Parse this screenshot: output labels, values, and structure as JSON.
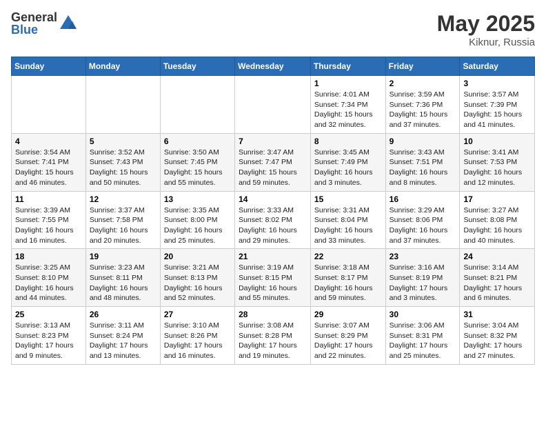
{
  "header": {
    "logo_general": "General",
    "logo_blue": "Blue",
    "month_year": "May 2025",
    "location": "Kiknur, Russia"
  },
  "days_of_week": [
    "Sunday",
    "Monday",
    "Tuesday",
    "Wednesday",
    "Thursday",
    "Friday",
    "Saturday"
  ],
  "weeks": [
    [
      {
        "day": "",
        "info": ""
      },
      {
        "day": "",
        "info": ""
      },
      {
        "day": "",
        "info": ""
      },
      {
        "day": "",
        "info": ""
      },
      {
        "day": "1",
        "info": "Sunrise: 4:01 AM\nSunset: 7:34 PM\nDaylight: 15 hours\nand 32 minutes."
      },
      {
        "day": "2",
        "info": "Sunrise: 3:59 AM\nSunset: 7:36 PM\nDaylight: 15 hours\nand 37 minutes."
      },
      {
        "day": "3",
        "info": "Sunrise: 3:57 AM\nSunset: 7:39 PM\nDaylight: 15 hours\nand 41 minutes."
      }
    ],
    [
      {
        "day": "4",
        "info": "Sunrise: 3:54 AM\nSunset: 7:41 PM\nDaylight: 15 hours\nand 46 minutes."
      },
      {
        "day": "5",
        "info": "Sunrise: 3:52 AM\nSunset: 7:43 PM\nDaylight: 15 hours\nand 50 minutes."
      },
      {
        "day": "6",
        "info": "Sunrise: 3:50 AM\nSunset: 7:45 PM\nDaylight: 15 hours\nand 55 minutes."
      },
      {
        "day": "7",
        "info": "Sunrise: 3:47 AM\nSunset: 7:47 PM\nDaylight: 15 hours\nand 59 minutes."
      },
      {
        "day": "8",
        "info": "Sunrise: 3:45 AM\nSunset: 7:49 PM\nDaylight: 16 hours\nand 3 minutes."
      },
      {
        "day": "9",
        "info": "Sunrise: 3:43 AM\nSunset: 7:51 PM\nDaylight: 16 hours\nand 8 minutes."
      },
      {
        "day": "10",
        "info": "Sunrise: 3:41 AM\nSunset: 7:53 PM\nDaylight: 16 hours\nand 12 minutes."
      }
    ],
    [
      {
        "day": "11",
        "info": "Sunrise: 3:39 AM\nSunset: 7:55 PM\nDaylight: 16 hours\nand 16 minutes."
      },
      {
        "day": "12",
        "info": "Sunrise: 3:37 AM\nSunset: 7:58 PM\nDaylight: 16 hours\nand 20 minutes."
      },
      {
        "day": "13",
        "info": "Sunrise: 3:35 AM\nSunset: 8:00 PM\nDaylight: 16 hours\nand 25 minutes."
      },
      {
        "day": "14",
        "info": "Sunrise: 3:33 AM\nSunset: 8:02 PM\nDaylight: 16 hours\nand 29 minutes."
      },
      {
        "day": "15",
        "info": "Sunrise: 3:31 AM\nSunset: 8:04 PM\nDaylight: 16 hours\nand 33 minutes."
      },
      {
        "day": "16",
        "info": "Sunrise: 3:29 AM\nSunset: 8:06 PM\nDaylight: 16 hours\nand 37 minutes."
      },
      {
        "day": "17",
        "info": "Sunrise: 3:27 AM\nSunset: 8:08 PM\nDaylight: 16 hours\nand 40 minutes."
      }
    ],
    [
      {
        "day": "18",
        "info": "Sunrise: 3:25 AM\nSunset: 8:10 PM\nDaylight: 16 hours\nand 44 minutes."
      },
      {
        "day": "19",
        "info": "Sunrise: 3:23 AM\nSunset: 8:11 PM\nDaylight: 16 hours\nand 48 minutes."
      },
      {
        "day": "20",
        "info": "Sunrise: 3:21 AM\nSunset: 8:13 PM\nDaylight: 16 hours\nand 52 minutes."
      },
      {
        "day": "21",
        "info": "Sunrise: 3:19 AM\nSunset: 8:15 PM\nDaylight: 16 hours\nand 55 minutes."
      },
      {
        "day": "22",
        "info": "Sunrise: 3:18 AM\nSunset: 8:17 PM\nDaylight: 16 hours\nand 59 minutes."
      },
      {
        "day": "23",
        "info": "Sunrise: 3:16 AM\nSunset: 8:19 PM\nDaylight: 17 hours\nand 3 minutes."
      },
      {
        "day": "24",
        "info": "Sunrise: 3:14 AM\nSunset: 8:21 PM\nDaylight: 17 hours\nand 6 minutes."
      }
    ],
    [
      {
        "day": "25",
        "info": "Sunrise: 3:13 AM\nSunset: 8:23 PM\nDaylight: 17 hours\nand 9 minutes."
      },
      {
        "day": "26",
        "info": "Sunrise: 3:11 AM\nSunset: 8:24 PM\nDaylight: 17 hours\nand 13 minutes."
      },
      {
        "day": "27",
        "info": "Sunrise: 3:10 AM\nSunset: 8:26 PM\nDaylight: 17 hours\nand 16 minutes."
      },
      {
        "day": "28",
        "info": "Sunrise: 3:08 AM\nSunset: 8:28 PM\nDaylight: 17 hours\nand 19 minutes."
      },
      {
        "day": "29",
        "info": "Sunrise: 3:07 AM\nSunset: 8:29 PM\nDaylight: 17 hours\nand 22 minutes."
      },
      {
        "day": "30",
        "info": "Sunrise: 3:06 AM\nSunset: 8:31 PM\nDaylight: 17 hours\nand 25 minutes."
      },
      {
        "day": "31",
        "info": "Sunrise: 3:04 AM\nSunset: 8:32 PM\nDaylight: 17 hours\nand 27 minutes."
      }
    ]
  ]
}
